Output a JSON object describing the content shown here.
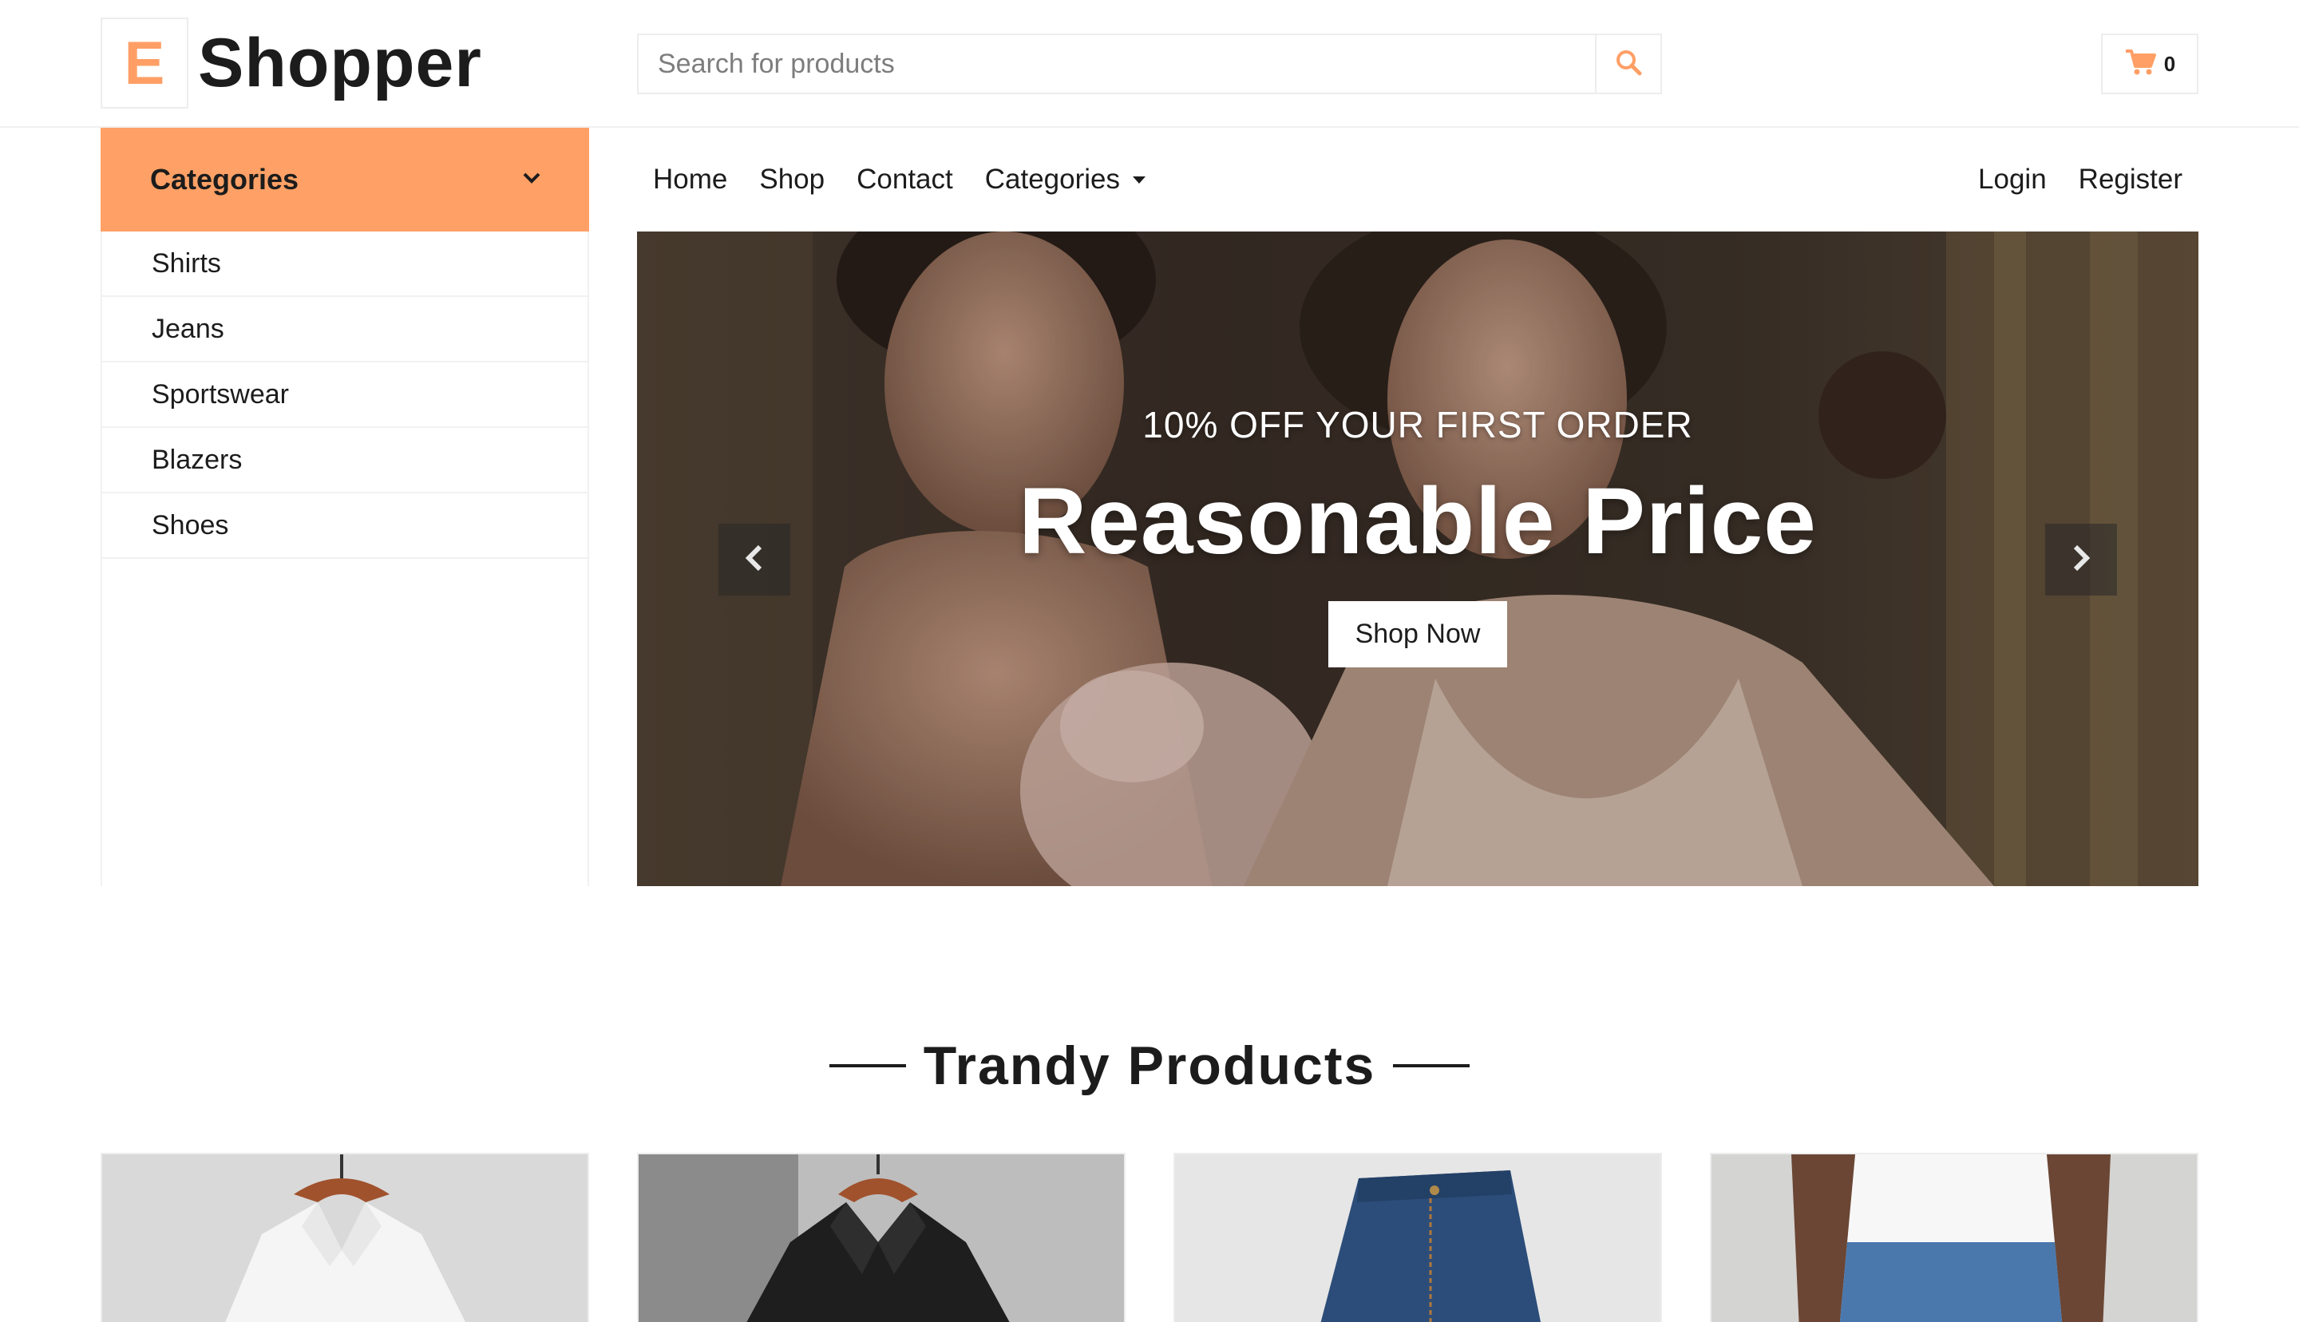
{
  "brand": {
    "logo_letter": "E",
    "name": "Shopper"
  },
  "search": {
    "placeholder": "Search for products"
  },
  "cart": {
    "count": "0"
  },
  "sidebar": {
    "header_label": "Categories",
    "items": [
      {
        "label": "Shirts"
      },
      {
        "label": "Jeans"
      },
      {
        "label": "Sportswear"
      },
      {
        "label": "Blazers"
      },
      {
        "label": "Shoes"
      }
    ]
  },
  "nav": {
    "left": [
      {
        "label": "Home"
      },
      {
        "label": "Shop"
      },
      {
        "label": "Contact"
      },
      {
        "label": "Categories"
      }
    ],
    "right": [
      {
        "label": "Login"
      },
      {
        "label": "Register"
      }
    ]
  },
  "hero": {
    "subtitle": "10% OFF YOUR FIRST ORDER",
    "title": "Reasonable Price",
    "button_label": "Shop Now"
  },
  "section": {
    "title": "Trandy Products"
  },
  "colors": {
    "accent": "#ffa166",
    "text": "#1c1c1c",
    "border": "#ededed"
  }
}
